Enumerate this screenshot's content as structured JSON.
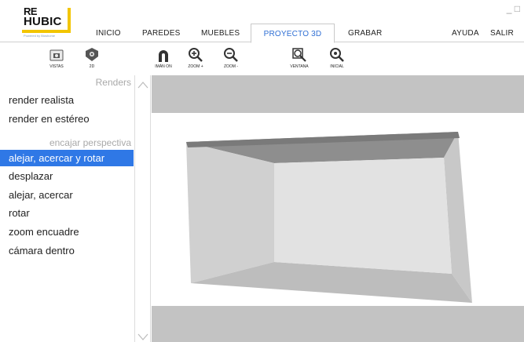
{
  "app": {
    "logo": {
      "line1": "RE",
      "line2": "HUBIC",
      "tagline": "Powered by Bioshome"
    },
    "brand_color": "#f2c500",
    "accent_color": "#2f78e6"
  },
  "menu": {
    "items": [
      "INICIO",
      "PAREDES",
      "MUEBLES",
      "PROYECTO 3D",
      "GRABAR",
      "AYUDA",
      "SALIR"
    ],
    "active": "PROYECTO 3D"
  },
  "window_controls": {
    "minimize": "_",
    "maximize": "□"
  },
  "toolbar": {
    "tools": [
      {
        "label": "VISTAS",
        "icon": "camera-icon"
      },
      {
        "label": "2D",
        "icon": "eye-2d-icon"
      },
      {
        "label": "IMÁN ON",
        "icon": "magnet-icon"
      },
      {
        "label": "ZOOM +",
        "icon": "zoom-in-icon"
      },
      {
        "label": "ZOOM -",
        "icon": "zoom-out-icon"
      },
      {
        "label": "VENTANA",
        "icon": "zoom-window-icon"
      },
      {
        "label": "INICIAL",
        "icon": "zoom-reset-icon"
      }
    ]
  },
  "left_panel": {
    "section_renders": "Renders",
    "renders": [
      "render realista",
      "render en estéreo"
    ],
    "section_perspective": "encajar perspectiva",
    "perspective": [
      "alejar, acercar y rotar",
      "desplazar",
      "alejar, acercar",
      "rotar",
      "zoom encuadre",
      "cámara dentro"
    ],
    "selected": "alejar, acercar y rotar"
  },
  "viewport": {
    "band_color": "#c3c3c3",
    "room": {
      "ceiling_color": "#8e8e8e",
      "floor_color": "#bdbdbd",
      "left_wall_color": "#d0d0d0",
      "right_wall_color": "#c8c8c8",
      "back_wall_color": "#e2e2e2"
    }
  }
}
